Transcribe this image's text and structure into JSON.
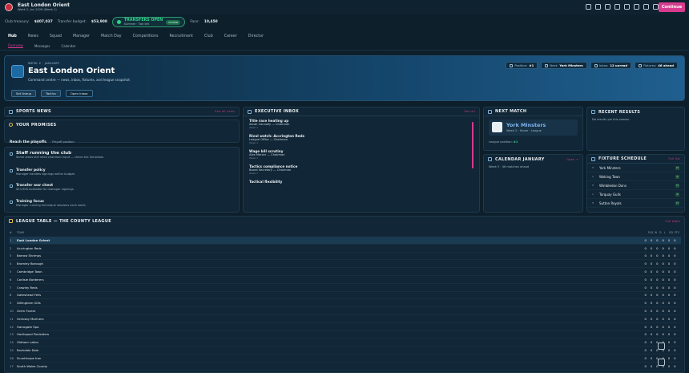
{
  "header": {
    "club_name": "East London Orient",
    "subtitle": "Week 2, Jan 2026 (Week 1)",
    "continue_label": "Continue"
  },
  "status": {
    "treasury_label": "Club treasury:",
    "treasury_value": "$407,037",
    "budget_label": "Transfer budget:",
    "budget_value": "$53,908",
    "transfers_label": "TRANSFERS OPEN",
    "transfers_sub": "Summer · 7wk left",
    "transfers_badge": "window",
    "fans_label": "Fans:",
    "fans_value": "10,450"
  },
  "nav": [
    "Hub",
    "News",
    "Squad",
    "Manager",
    "Match Day",
    "Competitions",
    "Recruitment",
    "Club",
    "Career",
    "Director"
  ],
  "subnav": [
    "Overview",
    "Messages",
    "Calendar"
  ],
  "hero": {
    "kicker": "WEEK 2 · JANUARY",
    "title": "East London Orient",
    "desc": "Command centre — news, inbox, fixtures, and league snapshot",
    "btn1": "Set lineup",
    "btn2": "Tactics",
    "btn3": "Open inbox",
    "pill1_label": "Position:",
    "pill1_value": "#1",
    "pill2_label": "Next:",
    "pill2_value": "York Minsters",
    "pill3_label": "Inbox:",
    "pill3_value": "12 unread",
    "pill4_label": "Fixtures:",
    "pill4_value": "46 ahead"
  },
  "sports_news": {
    "title": "SPORTS NEWS",
    "link": "See all news"
  },
  "promises": {
    "title": "YOUR PROMISES",
    "text": "Reach the playoffs",
    "sub": "· Playoff position"
  },
  "staff": {
    "title": "Staff running the club",
    "sub": "Some areas still need chairman input — check the list below.",
    "items": [
      {
        "title": "Transfer policy",
        "desc": "Manager handles signings within budget."
      },
      {
        "title": "Transfer war chest",
        "desc": "$53,908 available for manager signings."
      },
      {
        "title": "Training focus",
        "desc": "Manager running technique sessions each week."
      }
    ]
  },
  "inbox": {
    "title": "EXECUTIVE INBOX",
    "link": "See all",
    "items": [
      {
        "title": "Title race heating up",
        "sub": "Sarah Connolly — Chairman",
        "meta": "Week 1"
      },
      {
        "title": "Rival watch: Accrington Reds",
        "sub": "League Office — Chairman",
        "meta": "Week 1"
      },
      {
        "title": "Wage bill scrutiny",
        "sub": "Alex Mercer — Chairman",
        "meta": "Week 1"
      },
      {
        "title": "Tactics compliance notice",
        "sub": "Board Secretary — Chairman",
        "meta": "Week 1"
      },
      {
        "title": "Tactical flexibility",
        "sub": "",
        "meta": ""
      }
    ]
  },
  "next_match": {
    "title": "NEXT MATCH",
    "opponent": "York Minsters",
    "detail": "Week 2 · Home · League",
    "position_label": "League position:",
    "position_value": "#1"
  },
  "calendar": {
    "title": "CALENDAR JANUARY",
    "link": "Open →",
    "text": "Week 5 · 46 matches ahead"
  },
  "recent": {
    "title": "RECENT RESULTS",
    "text": "No results yet this season."
  },
  "fixtures": {
    "title": "FIXTURE SCHEDULE",
    "link": "Full list",
    "rows": [
      {
        "ha": "H",
        "opp": "York Minsters",
        "tag": "H"
      },
      {
        "ha": "A",
        "opp": "Woking Town",
        "tag": "A"
      },
      {
        "ha": "H",
        "opp": "Wimbledon Dons",
        "tag": "H"
      },
      {
        "ha": "A",
        "opp": "Torquay Gulls",
        "tag": "A"
      },
      {
        "ha": "H",
        "opp": "Sutton Royals",
        "tag": "H"
      }
    ]
  },
  "league": {
    "title": "LEAGUE TABLE — THE COUNTY LEAGUE",
    "link": "Full table",
    "headers": {
      "pos": "#",
      "team": "TEAM",
      "pld": "PLD",
      "w": "W",
      "d": "D",
      "l": "L",
      "gd": "GD",
      "pts": "PTS"
    },
    "rows": [
      "East London Orient",
      "Accrington Reds",
      "Barrow Shrimps",
      "Bromley Borough",
      "Cambridge Town",
      "Carlisle Borderers",
      "Crawley Reds",
      "Gateshead Fells",
      "Gillingham Gills",
      "Grein Forest",
      "Grimsby Mariners",
      "Harrogate Spa",
      "Hartlepool Poolsiders",
      "Oldham Latics",
      "Rochdale Dale",
      "Scunthorpe Iron",
      "South Wales County"
    ]
  },
  "colors": {
    "accent": "#d73b8f",
    "positive": "#2fd08a",
    "panel": "#112636"
  }
}
